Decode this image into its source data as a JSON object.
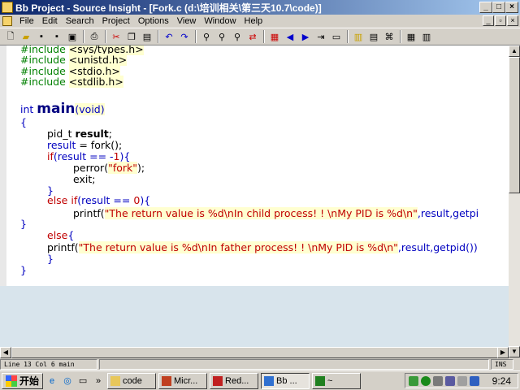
{
  "window": {
    "title": "Bb Project - Source Insight - [Fork.c (d:\\培训相关\\第三天10.7\\code)]"
  },
  "menu": [
    "File",
    "Edit",
    "Search",
    "Project",
    "Options",
    "View",
    "Window",
    "Help"
  ],
  "code": {
    "includes": [
      {
        "directive": "#include",
        "header": "<sys/types.h>"
      },
      {
        "directive": "#include",
        "header": "<unistd.h>"
      },
      {
        "directive": "#include",
        "header": "<stdio.h>"
      },
      {
        "directive": "#include",
        "header": "<stdlib.h>"
      }
    ],
    "main_type": "int",
    "main_name": "main",
    "main_params": "(void)",
    "open_brace": "{",
    "decl_type": "pid_t",
    "decl_var": "result",
    "semicolon": ";",
    "assign_lhs": "result",
    "assign_rest": " = fork();",
    "if_kw": "if",
    "if_cond_a": "(result == -",
    "if_num": "1",
    "if_cond_b": "){",
    "perror_call": "perror(",
    "perror_arg": "\"fork\"",
    "perror_end": ");",
    "exit_stmt": "exit;",
    "close_brace": "}",
    "elseif_kw": "else if",
    "elseif_cond_a": "(result == ",
    "elseif_num": "0",
    "elseif_cond_b": "){",
    "printf1_fn": "printf",
    "printf1_open": "(",
    "printf1_str": "\"The return value is %d\\nIn child process! ! \\nMy PID is %d\\n\"",
    "printf1_args": ",result,getpi",
    "else_kw": "else",
    "else_brace": "{",
    "printf2_fn": "printf",
    "printf2_open": "(",
    "printf2_str": "\"The return value is %d\\nIn father process! ! \\nMy PID is %d\\n\"",
    "printf2_args": ",result,getpid())"
  },
  "status": {
    "line": "Line 13",
    "col": "Col 6",
    "func": "main",
    "mode": "INS"
  },
  "taskbar": {
    "start": "开始",
    "tasks": [
      "code",
      "Micr...",
      "Red...",
      "Bb ...",
      "~"
    ],
    "clock": "9:24"
  },
  "colors": {
    "title_start": "#0a246a",
    "title_end": "#a6caf0",
    "editor_bg": "#ffffff",
    "lower_pane_bg": "#d8e4ec"
  },
  "icons": {
    "toolbar": [
      "new-file-icon",
      "open-icon",
      "save-icon",
      "save-all-icon",
      "close-file-icon",
      "print-icon",
      "cut-icon",
      "copy-icon",
      "paste-icon",
      "undo-icon",
      "redo-icon",
      "find-icon",
      "find-next-icon",
      "find-prev-icon",
      "replace-icon",
      "bookmark-icon",
      "back-icon",
      "forward-icon",
      "jump-icon",
      "browse-icon",
      "symbol-icon",
      "relation-icon",
      "sync-icon",
      "window-icon",
      "layout-icon"
    ]
  }
}
